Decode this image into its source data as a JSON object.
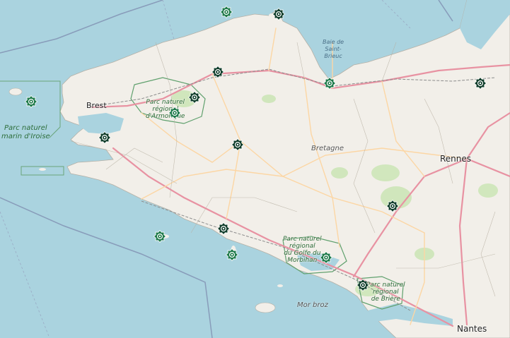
{
  "map": {
    "places": {
      "brest": "Brest",
      "rennes": "Rennes",
      "nantes": "Nantes",
      "region": "Bretagne",
      "baie_line1": "Baie de",
      "baie_line2": "Saint-",
      "baie_line3": "Brieuc",
      "mor_broz": "Mor broz"
    },
    "parks": {
      "iroise_line1": "Parc naturel",
      "iroise_line2": "marin d'Iroise",
      "armorique_line1": "Parc naturel",
      "armorique_line2": "régional",
      "armorique_line3": "d'Armorique",
      "golfe_line1": "Parc naturel",
      "golfe_line2": "régional",
      "golfe_line3": "du Golfe du",
      "golfe_line4": "Morbihan",
      "briere_line1": "Parc naturel",
      "briere_line2": "régional",
      "briere_line3": "de Brière"
    },
    "marker_colors": {
      "dark": "#0f3d2a",
      "green": "#1e7a4a"
    }
  }
}
